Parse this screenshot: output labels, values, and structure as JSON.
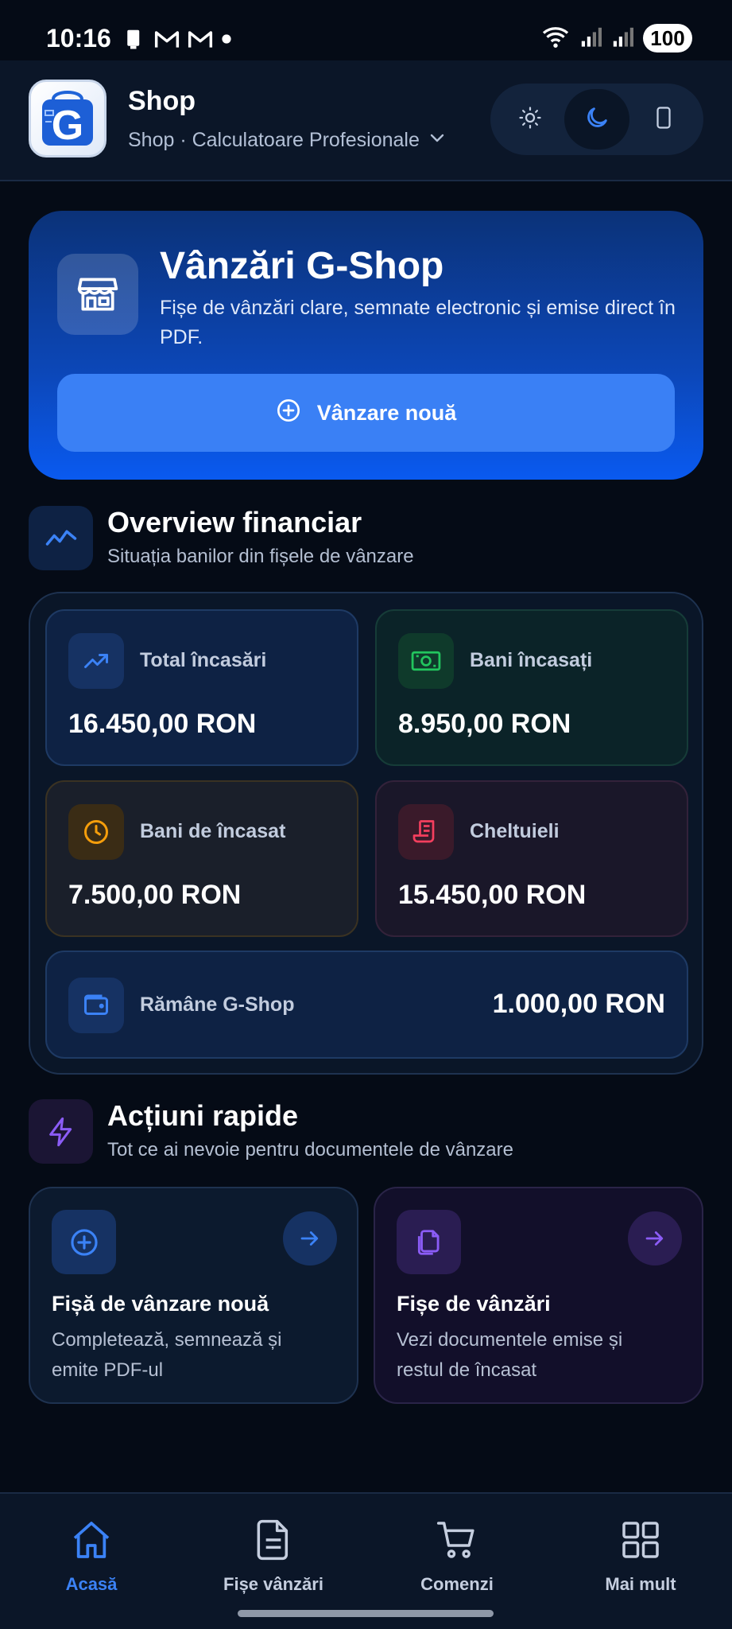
{
  "status_bar": {
    "time": "10:16",
    "battery": "100",
    "icons_left": [
      "download-icon",
      "gmail-icon",
      "gmail-icon",
      "dot-icon"
    ],
    "icons_right": [
      "wifi-icon",
      "signal-icon",
      "signal-icon",
      "battery-icon"
    ]
  },
  "header": {
    "app_name": "Shop",
    "subtitle": "Shop · Calculatoare Profesionale",
    "logo_icon": "g-shop-logo-icon",
    "theme_options": [
      "sun-icon",
      "moon-icon",
      "phone-icon"
    ],
    "active_theme": "moon-icon"
  },
  "hero": {
    "title": "Vânzări G-Shop",
    "description": "Fișe de vânzări clare, semnate electronic și emise direct în PDF.",
    "button_label": "Vânzare nouă",
    "icon": "store-icon"
  },
  "overview": {
    "title": "Overview financiar",
    "subtitle": "Situația banilor din fișele de vânzare",
    "icon": "trend-line-icon",
    "stats": [
      {
        "label": "Total încasări",
        "value": "16.450,00 RON",
        "icon": "trending-up-icon",
        "color": "#3b82f6"
      },
      {
        "label": "Bani încasați",
        "value": "8.950,00 RON",
        "icon": "banknote-icon",
        "color": "#22c55e"
      },
      {
        "label": "Bani de încasat",
        "value": "7.500,00 RON",
        "icon": "clock-icon",
        "color": "#f59e0b"
      },
      {
        "label": "Cheltuieli",
        "value": "15.450,00 RON",
        "icon": "receipt-icon",
        "color": "#f43f5e"
      }
    ],
    "remaining": {
      "label": "Rămâne G-Shop",
      "value": "1.000,00 RON",
      "icon": "wallet-icon"
    }
  },
  "quick_actions": {
    "title": "Acțiuni rapide",
    "subtitle": "Tot ce ai nevoie pentru documentele de vânzare",
    "icon": "lightning-icon",
    "items": [
      {
        "title": "Fișă de vânzare nouă",
        "description": "Completează, semnează și emite PDF-ul",
        "icon": "plus-circle-icon",
        "color": "#3b82f6"
      },
      {
        "title": "Fișe de vânzări",
        "description": "Vezi documentele emise și restul de încasat",
        "icon": "documents-icon",
        "color": "#8b5cf6"
      }
    ]
  },
  "bottom_nav": [
    {
      "label": "Acasă",
      "icon": "home-icon",
      "active": true
    },
    {
      "label": "Fișe vânzări",
      "icon": "document-icon",
      "active": false
    },
    {
      "label": "Comenzi",
      "icon": "cart-icon",
      "active": false
    },
    {
      "label": "Mai mult",
      "icon": "grid-icon",
      "active": false
    }
  ]
}
